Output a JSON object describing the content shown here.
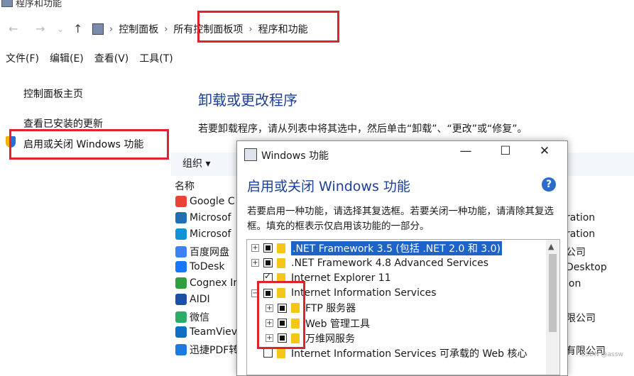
{
  "window": {
    "title": "程序和功能"
  },
  "breadcrumb": {
    "items": [
      "控制面板",
      "所有控制面板项",
      "程序和功能"
    ],
    "separator": "›"
  },
  "nav": {
    "back": "←",
    "forward": "→",
    "history": "⌄",
    "up": "↑"
  },
  "menu": [
    "文件(F)",
    "编辑(E)",
    "查看(V)",
    "工具(T)"
  ],
  "left_panel": {
    "home": "控制面板主页",
    "updates": "查看已安装的更新",
    "features": "启用或关闭 Windows 功能"
  },
  "main": {
    "title": "卸载或更改程序",
    "description": "若要卸载程序，请从列表中将其选中，然后单击“卸载”、“更改”或“修复”。",
    "organize": "组织 ▾",
    "column_name": "名称"
  },
  "programs": [
    {
      "name": "Google C",
      "color": "#ea4335"
    },
    {
      "name": "Microsof",
      "color": "#1f6fb5"
    },
    {
      "name": "Microsof",
      "color": "#1391d8"
    },
    {
      "name": "百度网盘",
      "color": "#3b82f6"
    },
    {
      "name": "ToDesk",
      "color": "#1677ff"
    },
    {
      "name": "Cognex Ir",
      "color": "#2e9e3e"
    },
    {
      "name": "AIDI",
      "color": "#1c4fa8"
    },
    {
      "name": "微信",
      "color": "#2aae67"
    },
    {
      "name": "TeamViev",
      "color": "#0e6fc7"
    },
    {
      "name": "迅捷PDF转",
      "color": "#1d7be0"
    }
  ],
  "program_right": [
    "ration",
    "ration",
    "公司",
    "Desktop",
    "ion",
    "限公司",
    "有限公司"
  ],
  "dialog": {
    "title": "Windows 功能",
    "heading": "启用或关闭 Windows 功能",
    "help": "?",
    "description": "若要启用一种功能，请选择其复选框。若要关闭一种功能，请清除其复选框。填充的框表示仅启用该功能的一部分。",
    "controls": {
      "minimize": "—",
      "maximize": "☐",
      "close": "✕"
    },
    "features": [
      {
        "label": ".NET Framework 3.5 (包括 .NET 2.0 和 3.0)",
        "state": "partial",
        "expandable": true,
        "level": 0,
        "selected": true
      },
      {
        "label": ".NET Framework 4.8 Advanced Services",
        "state": "partial",
        "expandable": true,
        "level": 0
      },
      {
        "label": "Internet Explorer 11",
        "state": "checked",
        "expandable": false,
        "level": 0
      },
      {
        "label": "Internet Information Services",
        "state": "partial",
        "expandable": true,
        "expanded": true,
        "level": 0
      },
      {
        "label": "FTP 服务器",
        "state": "partial",
        "expandable": true,
        "level": 1
      },
      {
        "label": "Web 管理工具",
        "state": "partial",
        "expandable": true,
        "level": 1
      },
      {
        "label": "万维网服务",
        "state": "partial",
        "expandable": true,
        "level": 1
      },
      {
        "label": "Internet Information Services 可承载的 Web 核心",
        "state": "unchecked",
        "expandable": false,
        "level": 0
      }
    ]
  },
  "watermark": "CSDN @assw",
  "colors": {
    "accent": "#1c3f96",
    "highlight": "#e0222a",
    "selection": "#1e63c8"
  }
}
